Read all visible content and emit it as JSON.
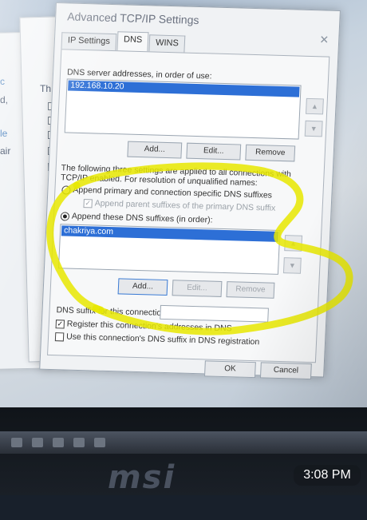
{
  "dialog": {
    "title": "Advanced TCP/IP Settings",
    "tabs": [
      {
        "label": "IP Settings"
      },
      {
        "label": "DNS"
      },
      {
        "label": "WINS"
      }
    ],
    "dns_servers": {
      "label": "DNS server addresses, in order of use:",
      "items": [
        "192.168.10.20"
      ]
    },
    "buttons_top": {
      "add": "Add...",
      "edit": "Edit...",
      "remove": "Remove"
    },
    "info_text": {
      "line1": "The following three settings are applied to all connections with",
      "line2": "TCP/IP enabled. For resolution of unqualified names:"
    },
    "radio_primary": "Append primary and connection specific DNS suffixes",
    "check_parent": "Append parent suffixes of the primary DNS suffix",
    "radio_these": "Append these DNS suffixes (in order):",
    "suffix_list": {
      "items": [
        "chakriya.com"
      ]
    },
    "buttons_mid": {
      "add": "Add...",
      "edit": "Edit...",
      "remove": "Remove"
    },
    "dns_suffix_label": "DNS suffix for this connection:",
    "dns_suffix_value": "",
    "check_register": "Register this connection's addresses in DNS",
    "check_use_suffix": "Use this connection's DNS suffix in DNS registration",
    "ok": "OK",
    "cancel": "Cancel",
    "accent": "#2d6fd6",
    "highlight_color": "#e8e800"
  },
  "background": {
    "brand": "msi",
    "left_text": [
      "c",
      "d,",
      "le",
      "air"
    ],
    "middle_text": "Th"
  },
  "overlay": {
    "time": "3:08 PM"
  }
}
